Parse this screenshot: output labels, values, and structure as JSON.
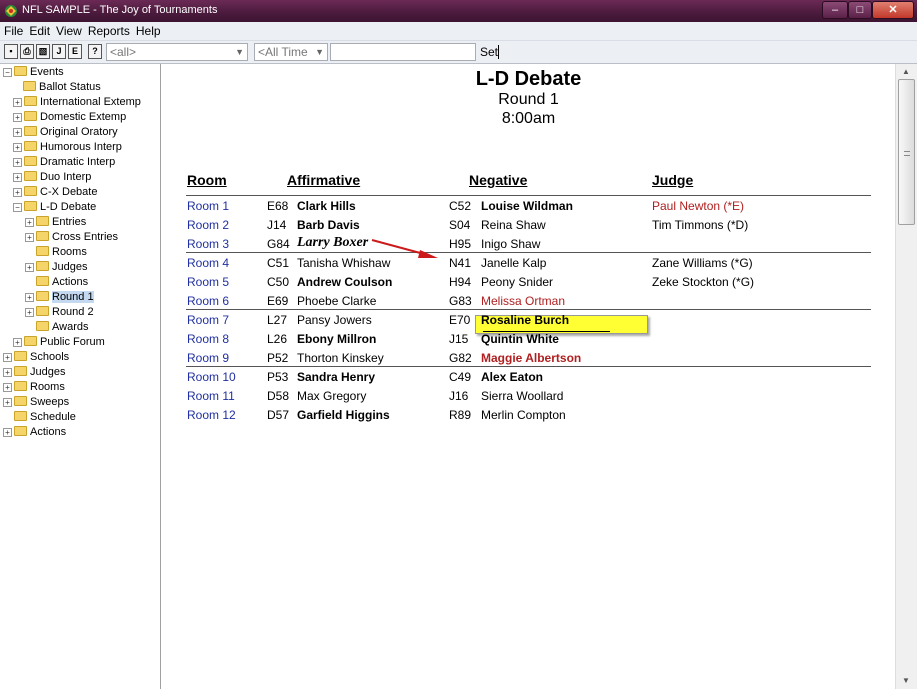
{
  "window": {
    "title": "NFL SAMPLE - The Joy of Tournaments",
    "min": "–",
    "max": "□",
    "close": "✕"
  },
  "menu": [
    "File",
    "Edit",
    "View",
    "Reports",
    "Help"
  ],
  "toolbar": {
    "buttons": [
      "▪",
      "⎙",
      "▧",
      "J",
      "E",
      "?"
    ],
    "scope_value": "<all>",
    "time_value": "<All Time",
    "search_value": "",
    "set_label": "Set"
  },
  "tree": [
    {
      "label": "Events",
      "exp": "−"
    },
    {
      "label": "Ballot Status",
      "exp": ""
    },
    {
      "label": "International Extemp",
      "exp": "+"
    },
    {
      "label": "Domestic Extemp",
      "exp": "+"
    },
    {
      "label": "Original Oratory",
      "exp": "+"
    },
    {
      "label": "Humorous Interp",
      "exp": "+"
    },
    {
      "label": "Dramatic Interp",
      "exp": "+"
    },
    {
      "label": "Duo Interp",
      "exp": "+"
    },
    {
      "label": "C-X Debate",
      "exp": "+"
    },
    {
      "label": "L-D Debate",
      "exp": "−"
    },
    {
      "label": "Entries",
      "exp": "+"
    },
    {
      "label": "Cross Entries",
      "exp": "+"
    },
    {
      "label": "Rooms",
      "exp": ""
    },
    {
      "label": "Judges",
      "exp": "+"
    },
    {
      "label": "Actions",
      "exp": ""
    },
    {
      "label": "Round 1",
      "exp": "+"
    },
    {
      "label": "Round 2",
      "exp": "+"
    },
    {
      "label": "Awards",
      "exp": ""
    },
    {
      "label": "Public Forum",
      "exp": "+"
    },
    {
      "label": "Schools",
      "exp": "+"
    },
    {
      "label": "Judges",
      "exp": "+"
    },
    {
      "label": "Rooms",
      "exp": "+"
    },
    {
      "label": "Sweeps",
      "exp": "+"
    },
    {
      "label": "Schedule",
      "exp": ""
    },
    {
      "label": "Actions",
      "exp": "+"
    }
  ],
  "report": {
    "title": "L-D Debate",
    "round": "Round 1",
    "time": "8:00am",
    "headers": {
      "room": "Room",
      "affirmative": "Affirmative",
      "negative": "Negative",
      "judge": "Judge"
    },
    "rows": [
      {
        "room": "Room 1",
        "acode": "E68",
        "aname": "Clark Hills",
        "ncode": "C52",
        "nname": "Louise Wildman",
        "judge": "Paul Newton (*E)"
      },
      {
        "room": "Room 2",
        "acode": "J14",
        "aname": "Barb Davis",
        "ncode": "S04",
        "nname": "Reina Shaw",
        "judge": "Tim Timmons (*D)"
      },
      {
        "room": "Room 3",
        "acode": "G84",
        "aname": "Larry Boxer",
        "ncode": "H95",
        "nname": "Inigo Shaw",
        "judge": ""
      },
      {
        "room": "Room 4",
        "acode": "C51",
        "aname": "Tanisha Whishaw",
        "ncode": "N41",
        "nname": "Janelle Kalp",
        "judge": "Zane Williams (*G)"
      },
      {
        "room": "Room 5",
        "acode": "C50",
        "aname": "Andrew Coulson",
        "ncode": "H94",
        "nname": "Peony Snider",
        "judge": "Zeke Stockton (*G)"
      },
      {
        "room": "Room 6",
        "acode": "E69",
        "aname": "Phoebe Clarke",
        "ncode": "G83",
        "nname": "Melissa Ortman",
        "judge": ""
      },
      {
        "room": "Room 7",
        "acode": "L27",
        "aname": "Pansy Jowers",
        "ncode": "E70",
        "nname": "Rosaline Burch",
        "judge": ""
      },
      {
        "room": "Room 8",
        "acode": "L26",
        "aname": "Ebony Millron",
        "ncode": "J15",
        "nname": "Quintin White",
        "judge": ""
      },
      {
        "room": "Room 9",
        "acode": "P52",
        "aname": "Thorton Kinskey",
        "ncode": "G82",
        "nname": "Maggie Albertson",
        "judge": ""
      },
      {
        "room": "Room 10",
        "acode": "P53",
        "aname": "Sandra Henry",
        "ncode": "C49",
        "nname": "Alex Eaton",
        "judge": ""
      },
      {
        "room": "Room 11",
        "acode": "D58",
        "aname": "Max Gregory",
        "ncode": "J16",
        "nname": "Sierra Woollard",
        "judge": ""
      },
      {
        "room": "Room 12",
        "acode": "D57",
        "aname": "Garfield Higgins",
        "ncode": "R89",
        "nname": "Merlin Compton",
        "judge": ""
      }
    ]
  },
  "colors": {
    "room_link": "#2030a0",
    "warning_red": "#b02020",
    "highlight": "#ffff33",
    "drag_arrow": "#cc1a1a"
  },
  "scrollbar": {
    "up": "▲",
    "down": "▼"
  }
}
